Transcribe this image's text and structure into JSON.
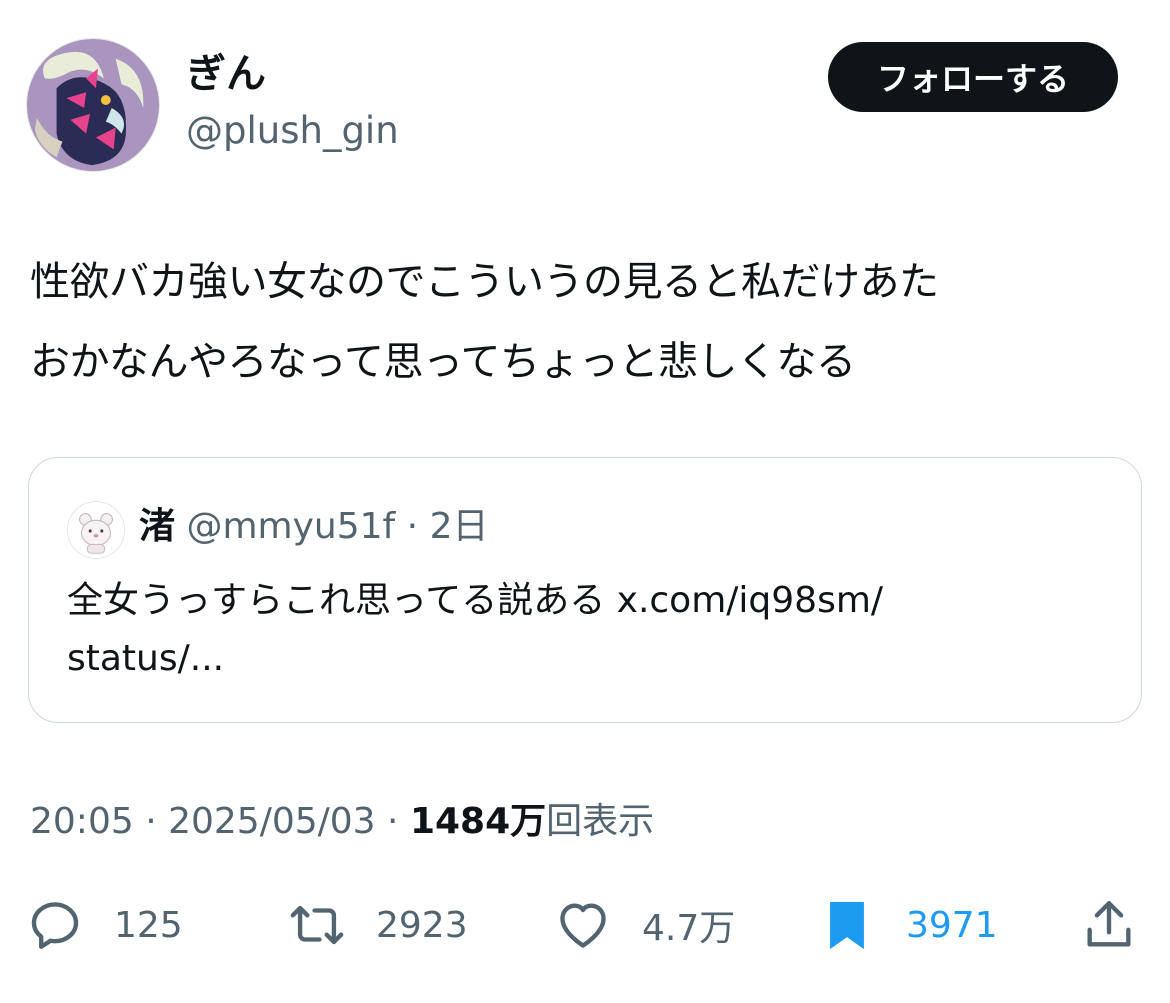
{
  "author": {
    "name": "ぎん",
    "handle": "@plush_gin",
    "avatar_icon": "character-avatar-icon"
  },
  "follow_button": {
    "label": "フォローする"
  },
  "tweet": {
    "line1": "性欲バカ強い女なのでこういうの見ると私だけあた",
    "line2": "おかなんやろなって思ってちょっと悲しくなる"
  },
  "quote": {
    "name": "渚",
    "handle": "@mmyu51f",
    "sep": "·",
    "time": "2日",
    "line1": "全女うっすらこれ思ってる説ある x.com/iq98sm/",
    "line2": "status/..."
  },
  "meta": {
    "time": "20:05",
    "sep1": " · ",
    "date": "2025/05/03",
    "sep2": " · ",
    "views_count": "1484万",
    "views_label": "回表示"
  },
  "actions": {
    "reply_count": "125",
    "retweet_count": "2923",
    "like_count": "4.7万",
    "bookmark_count": "3971"
  },
  "colors": {
    "text_primary": "#0f1419",
    "text_secondary": "#536471",
    "accent": "#1d9bf0",
    "border": "#cfd9de"
  }
}
